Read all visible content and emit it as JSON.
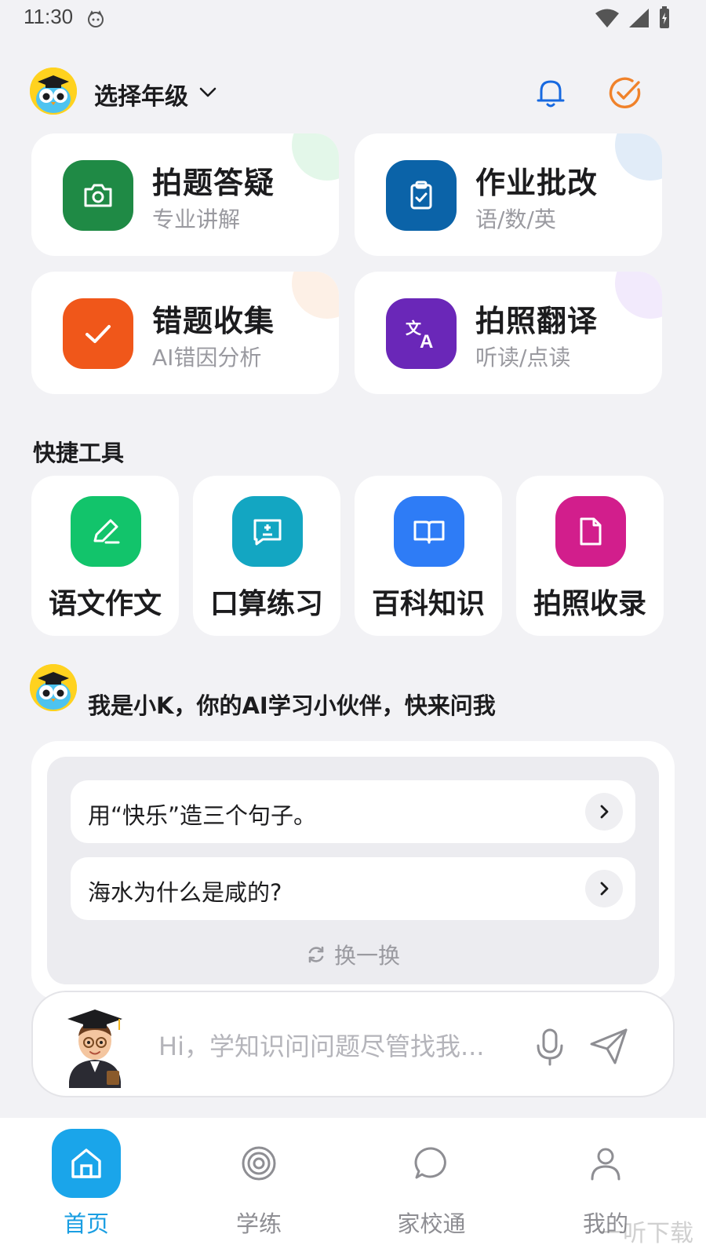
{
  "status_bar": {
    "time": "11:30"
  },
  "header": {
    "grade_label": "选择年级"
  },
  "features": [
    {
      "title": "拍题答疑",
      "subtitle": "专业讲解",
      "icon": "camera-icon",
      "color": "#1f8a45",
      "deco_color": "#e3f7e9"
    },
    {
      "title": "作业批改",
      "subtitle": "语/数/英",
      "icon": "clipboard-check-icon",
      "color": "#0b63a8",
      "deco_color": "#e1ecf8"
    },
    {
      "title": "错题收集",
      "subtitle": "AI错因分析",
      "icon": "check-icon",
      "color": "#f0571a",
      "deco_color": "#fdf0e6"
    },
    {
      "title": "拍照翻译",
      "subtitle": "听读/点读",
      "icon": "translate-icon",
      "color": "#6a27b8",
      "deco_color": "#f2eafc"
    }
  ],
  "quick_tools": {
    "title": "快捷工具",
    "items": [
      {
        "label": "语文作文",
        "icon": "pencil-icon",
        "color": "#12c46b"
      },
      {
        "label": "口算练习",
        "icon": "calc-message-icon",
        "color": "#13a6c2"
      },
      {
        "label": "百科知识",
        "icon": "book-icon",
        "color": "#2e7cf6"
      },
      {
        "label": "拍照收录",
        "icon": "document-icon",
        "color": "#d21e8c"
      }
    ]
  },
  "assistant": {
    "intro": "我是小K，你的AI学习小伙伴，快来问我",
    "questions": [
      "用“快乐”造三个句子。",
      "海水为什么是咸的?"
    ],
    "refresh_label": "换一换",
    "input_placeholder": "Hi，学知识问问题尽管找我..."
  },
  "bottom_nav": [
    {
      "label": "首页",
      "icon": "home-icon",
      "active": true
    },
    {
      "label": "学练",
      "icon": "target-icon",
      "active": false
    },
    {
      "label": "家校通",
      "icon": "chat-bubble-icon",
      "active": false
    },
    {
      "label": "我的",
      "icon": "user-icon",
      "active": false
    }
  ],
  "watermark": "一听下载",
  "colors": {
    "accent": "#1aa5ea",
    "background": "#f2f2f5"
  }
}
